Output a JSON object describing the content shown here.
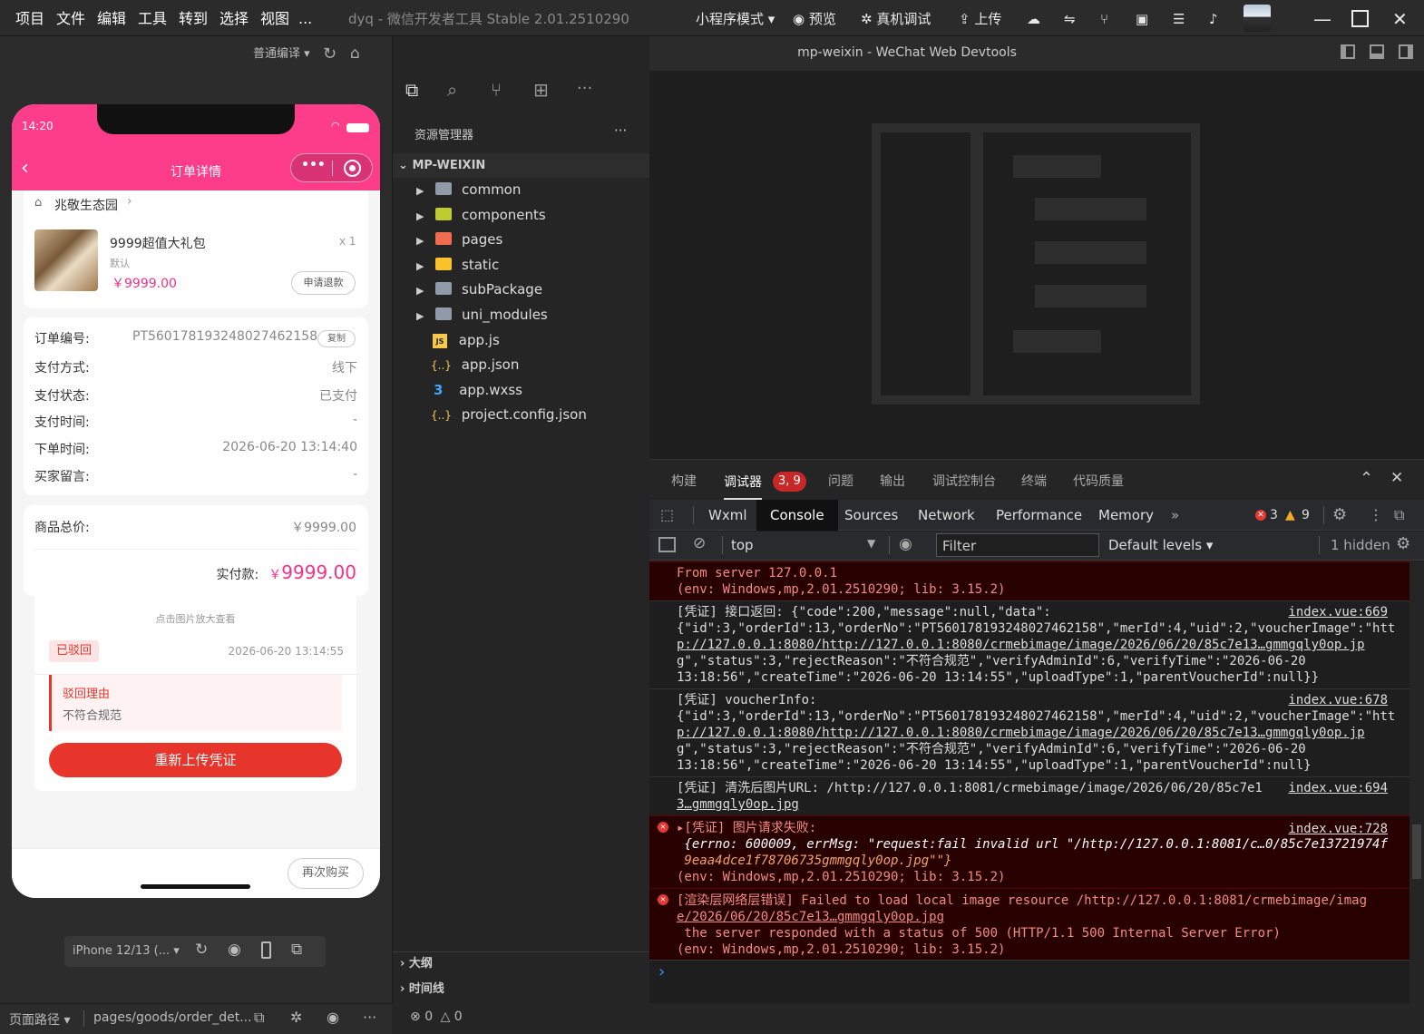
{
  "menu": [
    "项目",
    "文件",
    "编辑",
    "工具",
    "转到",
    "选择",
    "视图",
    "..."
  ],
  "window_title": "dyq - 微信开发者工具 Stable 2.01.2510290",
  "toolbar": {
    "mode": "小程序模式 ▾",
    "preview": "预览",
    "debug": "真机调试",
    "upload": "上传"
  },
  "sim_toolbar": {
    "compile": "普通编译 ▾"
  },
  "panel_title": "mp-weixin - WeChat Web Devtools",
  "phone": {
    "time": "14:20",
    "nav_title": "订单详情",
    "capsule_dots": "•••",
    "shop_name": "兆敬生态园",
    "product": {
      "name": "9999超值大礼包",
      "qty": "x 1",
      "spec": "默认",
      "price": "￥9999.00",
      "refund_btn": "申请退款"
    },
    "order_rows": [
      {
        "label": "订单编号:",
        "value": "PT560178193248027462158"
      },
      {
        "label": "支付方式:",
        "value": "线下"
      },
      {
        "label": "支付状态:",
        "value": "已支付"
      },
      {
        "label": "支付时间:",
        "value": "-"
      },
      {
        "label": "下单时间:",
        "value": "2026-06-20 13:14:40"
      },
      {
        "label": "买家留言:",
        "value": "-"
      }
    ],
    "copy_btn": "复制",
    "total_label": "商品总价:",
    "total_value": "￥9999.00",
    "paid_label": "实付款:",
    "paid_symbol": "￥",
    "paid_value": "9999.00",
    "voucher": {
      "hint": "点击图片放大查看",
      "status": "已驳回",
      "time": "2026-06-20 13:14:55",
      "reason_title": "驳回理由",
      "reason_text": "不符合规范",
      "reupload_btn": "重新上传凭证"
    },
    "buy_again": "再次购买"
  },
  "device": {
    "model": "iPhone 12/13 (... ▾"
  },
  "bottom_left": {
    "path_label": "页面路径 ▾",
    "path_value": "pages/goods/order_det..."
  },
  "explorer": {
    "title": "资源管理器",
    "more": "···",
    "project": "MP-WEIXIN",
    "folders": [
      "common",
      "components",
      "pages",
      "static",
      "subPackage",
      "uni_modules"
    ],
    "files": [
      {
        "name": "app.js",
        "badge": "JS"
      },
      {
        "name": "app.json",
        "badge": "{..}"
      },
      {
        "name": "app.wxss",
        "badge": "3"
      },
      {
        "name": "project.config.json",
        "badge": "{..}"
      }
    ],
    "outline": "大纲",
    "timeline": "时间线"
  },
  "devtools_tabs": [
    "构建",
    "调试器",
    "问题",
    "输出",
    "调试控制台",
    "终端",
    "代码质量"
  ],
  "debugger_badge": "3, 9",
  "console_tabs": [
    "Wxml",
    "Console",
    "Sources",
    "Network",
    "Performance",
    "Memory"
  ],
  "counts": {
    "errors": "3",
    "warnings": "9"
  },
  "filter_bar": {
    "context": "top",
    "filter_placeholder": "Filter",
    "levels": "Default levels ▾",
    "hidden": "1 hidden"
  },
  "logs": [
    {
      "type": "err",
      "lines": [
        "From server 127.0.0.1",
        "(env: Windows,mp,2.01.2510290; lib: 3.15.2)"
      ]
    },
    {
      "type": "info",
      "src": "index.vue:669",
      "lines": [
        "[凭证] 接口返回: {\"code\":200,\"message\":null,\"data\":",
        "{\"id\":3,\"orderId\":13,\"orderNo\":\"PT560178193248027462158\",\"merId\":4,\"uid\":2,\"voucherImage\":\"htt",
        "p://127.0.0.1:8080/http://127.0.0.1:8080/crmebimage/image/2026/06/20/85c7e13…gmmgqly0op.jp",
        "g\",\"status\":3,\"rejectReason\":\"不符合规范\",\"verifyAdminId\":6,\"verifyTime\":\"2026-06-20",
        "13:18:56\",\"createTime\":\"2026-06-20 13:14:55\",\"uploadType\":1,\"parentVoucherId\":null}}"
      ]
    },
    {
      "type": "info",
      "src": "index.vue:678",
      "lines": [
        "[凭证] voucherInfo:",
        "{\"id\":3,\"orderId\":13,\"orderNo\":\"PT560178193248027462158\",\"merId\":4,\"uid\":2,\"voucherImage\":\"htt",
        "p://127.0.0.1:8080/http://127.0.0.1:8080/crmebimage/image/2026/06/20/85c7e13…gmmgqly0op.jp",
        "g\",\"status\":3,\"rejectReason\":\"不符合规范\",\"verifyAdminId\":6,\"verifyTime\":\"2026-06-20",
        "13:18:56\",\"createTime\":\"2026-06-20 13:14:55\",\"uploadType\":1,\"parentVoucherId\":null}"
      ]
    },
    {
      "type": "info",
      "src": "index.vue:694",
      "lines": [
        "[凭证] 清洗后图片URL: /http://127.0.0.1:8081/crmebimage/image/2026/06/20/85c7e1",
        "3…gmmgqly0op.jpg"
      ]
    },
    {
      "type": "err",
      "src": "index.vue:728",
      "lines": [
        "▸[凭证] 图片请求失败:",
        " {errno: 600009, errMsg: \"request:fail invalid url \"/http://127.0.0.1:8081/c…0/85c7e13721974f",
        " 9eaa4dce1f78706735gmmgqly0op.jpg\"\"}",
        "(env: Windows,mp,2.01.2510290; lib: 3.15.2)"
      ]
    },
    {
      "type": "err",
      "lines": [
        "[渲染层网络层错误] Failed to load local image resource /http://127.0.0.1:8081/crmebimage/imag",
        "e/2026/06/20/85c7e13…gmmgqly0op.jpg",
        " the server responded with a status of 500 (HTTP/1.1 500 Internal Server Error)",
        "(env: Windows,mp,2.01.2510290; lib: 3.15.2)"
      ]
    }
  ],
  "prompt": "›",
  "status": {
    "errors": "0",
    "warnings": "0"
  },
  "colors": {
    "brand_pink": "#fd3d8a",
    "price_pink": "#f5308a",
    "reject_red": "#e8352b",
    "accent_blue": "#3794ff"
  }
}
